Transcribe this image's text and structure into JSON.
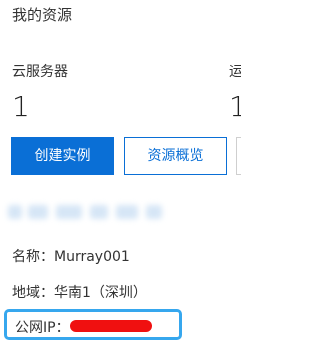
{
  "header": {
    "title": "我的资源"
  },
  "resources": {
    "items": [
      {
        "label": "云服务器",
        "count": "1"
      },
      {
        "label": "运",
        "count": "1"
      }
    ]
  },
  "actions": {
    "create_instance": "创建实例",
    "resource_overview": "资源概览"
  },
  "instance": {
    "name_label": "名称：",
    "name_value": "Murray001",
    "region_label": "地域：",
    "region_value": "华南1（深圳）",
    "ip_label": "公网IP："
  },
  "colors": {
    "primary": "#0a6fd6",
    "highlight": "#36a7ee",
    "redaction": "#f01010"
  }
}
